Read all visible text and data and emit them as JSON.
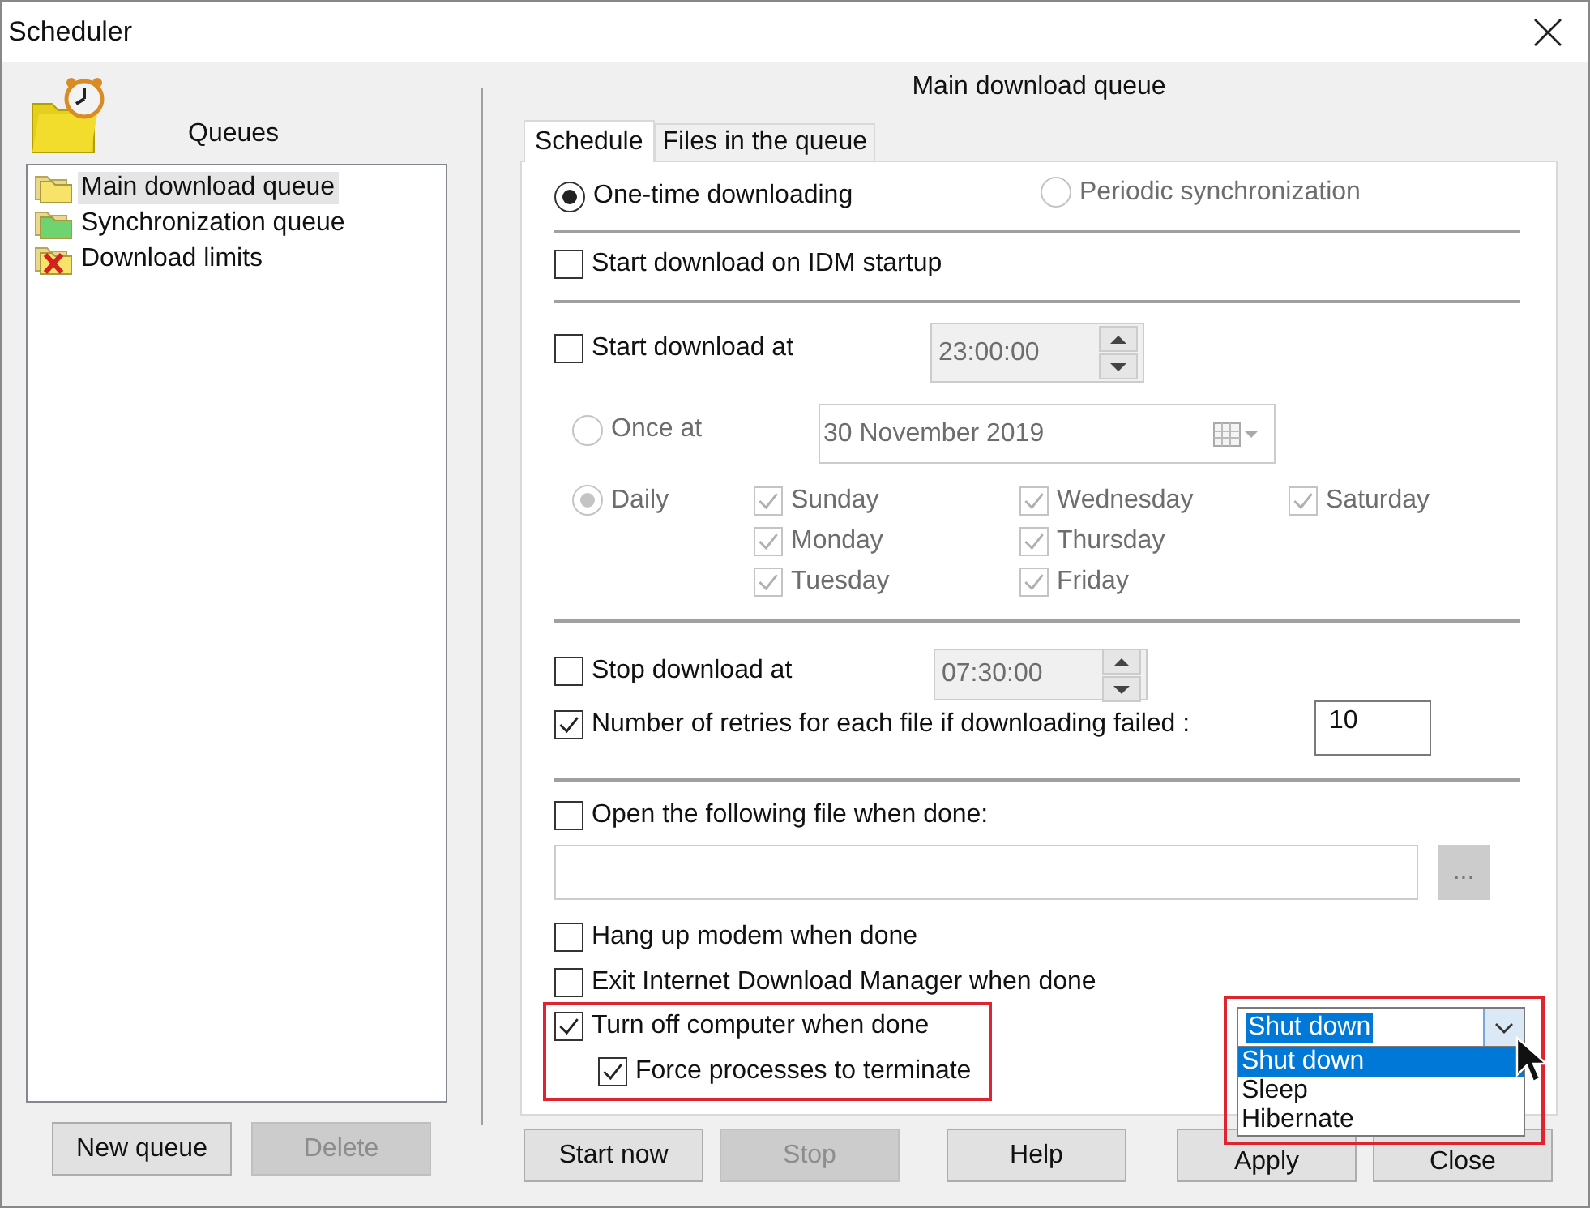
{
  "window": {
    "title": "Scheduler"
  },
  "sidebar": {
    "title": "Queues",
    "items": [
      {
        "label": "Main download queue",
        "kind": "main",
        "selected": true
      },
      {
        "label": "Synchronization queue",
        "kind": "sync",
        "selected": false
      },
      {
        "label": "Download limits",
        "kind": "limits",
        "selected": false
      }
    ],
    "buttons": [
      {
        "label": "New queue",
        "disabled": false
      },
      {
        "label": "Delete",
        "disabled": true
      }
    ]
  },
  "main": {
    "title": "Main download queue",
    "tabs": [
      {
        "label": "Schedule",
        "selected": true
      },
      {
        "label": "Files in the queue",
        "selected": false
      }
    ],
    "mode": [
      {
        "label": "One-time downloading",
        "selected": true,
        "disabled": false
      },
      {
        "label": "Periodic synchronization",
        "selected": false,
        "disabled": true
      }
    ],
    "start_on_startup": {
      "label": "Start download on IDM startup",
      "checked": false
    },
    "start_at": {
      "label": "Start download at",
      "checked": false,
      "time": "23:00:00"
    },
    "once_at": {
      "label": "Once at",
      "selected": false,
      "date": "30 November 2019"
    },
    "daily": {
      "label": "Daily",
      "selected": true,
      "days": [
        {
          "label": "Sunday",
          "checked": true
        },
        {
          "label": "Monday",
          "checked": true
        },
        {
          "label": "Tuesday",
          "checked": true
        },
        {
          "label": "Wednesday",
          "checked": true
        },
        {
          "label": "Thursday",
          "checked": true
        },
        {
          "label": "Friday",
          "checked": true
        },
        {
          "label": "Saturday",
          "checked": true
        }
      ]
    },
    "stop_at": {
      "label": "Stop download at",
      "checked": false,
      "time": "07:30:00"
    },
    "retries": {
      "label": "Number of retries for each file if downloading failed :",
      "checked": true,
      "value": "10"
    },
    "open_file": {
      "label": "Open the following file when done:",
      "checked": false
    },
    "browse_button": "...",
    "hang_up": {
      "label": "Hang up modem when done",
      "checked": false
    },
    "exit_idm": {
      "label": "Exit Internet Download Manager when done",
      "checked": false
    },
    "turn_off": {
      "label": "Turn off computer when done",
      "checked": true
    },
    "force": {
      "label": "Force processes to terminate",
      "checked": true
    },
    "shutdown_combo": {
      "value": "Shut down",
      "expanded": true,
      "options": [
        {
          "label": "Shut down",
          "selected": true
        },
        {
          "label": "Sleep",
          "selected": false
        },
        {
          "label": "Hibernate",
          "selected": false
        }
      ]
    },
    "buttons": [
      {
        "label": "Start now",
        "disabled": false
      },
      {
        "label": "Stop",
        "disabled": true
      },
      {
        "label": "Help",
        "disabled": false
      },
      {
        "label": "Apply",
        "disabled": false
      },
      {
        "label": "Close",
        "disabled": false
      }
    ]
  }
}
